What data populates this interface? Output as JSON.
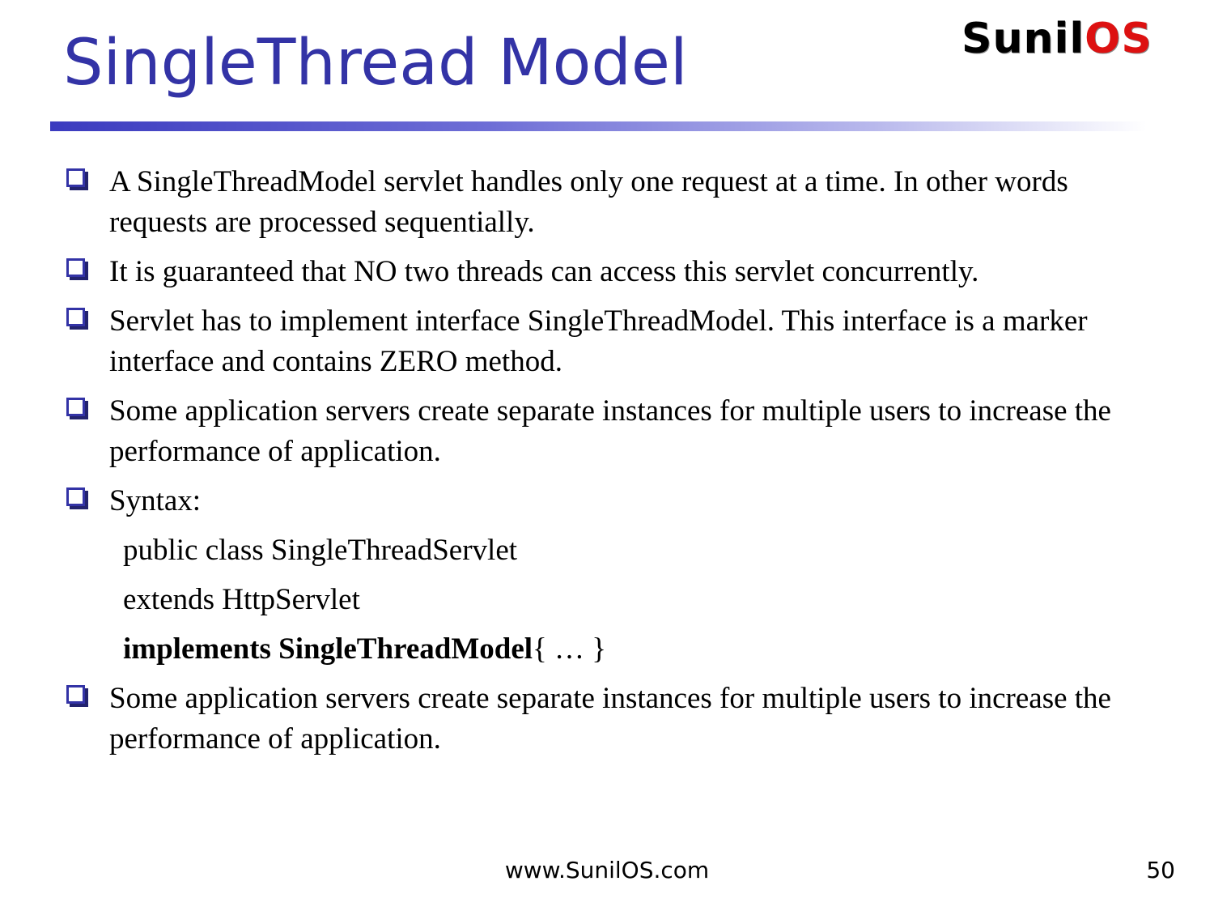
{
  "slide": {
    "title": "SingleThread Model",
    "logo": {
      "part1": "Sunil",
      "part2": "OS"
    },
    "bullets": [
      "A SingleThreadModel servlet handles only one request at a time. In other words requests are processed sequentially.",
      "It is guaranteed that NO two threads can access this servlet concurrently.",
      "Servlet has to implement interface SingleThreadModel. This interface is a marker interface and contains ZERO method.",
      "Some application servers create separate instances for multiple users to increase the performance of application.",
      "Syntax:"
    ],
    "code": {
      "line1": "public class SingleThreadServlet",
      "line2": "extends HttpServlet",
      "line3_bold": "implements SingleThreadModel",
      "line3_rest": "{ … }"
    },
    "last_bullet": "Some application servers create separate instances for multiple users to increase the performance of application.",
    "footer": {
      "url": "www.SunilOS.com",
      "page_number": "50"
    },
    "colors": {
      "title": "#3333a6",
      "logo_red": "#dd1111",
      "bullet_box": "#3333a6"
    }
  }
}
